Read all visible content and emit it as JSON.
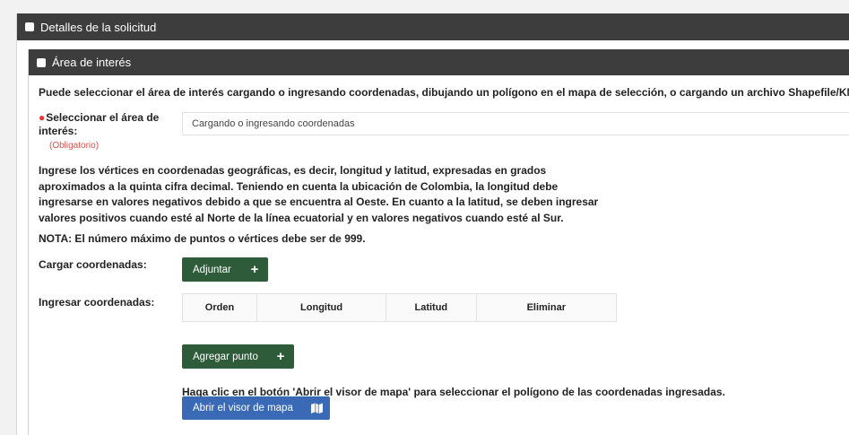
{
  "outer_panel": {
    "title": "Detalles de la solicitud"
  },
  "inner_panel": {
    "title": "Área de interés"
  },
  "intro_text": "Puede seleccionar el área de interés cargando o ingresando coordenadas, dibujando un polígono en el mapa de selección, o cargando un archivo Shapefile/KML",
  "select_area": {
    "label_line1": "Seleccionar el área de",
    "label_line2": "interés:",
    "required_note": "(Obligatorio)",
    "selected_value": "Cargando o ingresando coordenadas"
  },
  "instructions": "Ingrese los vértices en coordenadas geográficas, es decir, longitud y latitud, expresadas en grados aproximados a la quinta cifra decimal. Teniendo en cuenta la ubicación de Colombia, la longitud debe ingresarse en valores negativos debido a que se encuentra al Oeste. En cuanto a la latitud, se deben ingresar valores positivos cuando esté al Norte de la línea ecuatorial y en valores negativos cuando esté al Sur.",
  "nota": "NOTA: El número máximo de puntos o vértices debe ser de 999.",
  "upload": {
    "label": "Cargar coordenadas:",
    "button": "Adjuntar",
    "button_icon": "plus-icon"
  },
  "enter": {
    "label": "Ingresar coordenadas:",
    "columns": [
      "Orden",
      "Longitud",
      "Latitud",
      "Eliminar"
    ],
    "add_button": "Agregar punto",
    "add_icon": "plus-icon"
  },
  "map": {
    "hint": "Haga clic en el botón 'Abrir el visor de mapa' para seleccionar el polígono de las coordenadas ingresadas.",
    "button": "Abrir el visor de mapa",
    "button_icon": "map-icon"
  },
  "colors": {
    "header_bg": "#3d3d3d",
    "green_button": "#2e5b3a",
    "blue_button": "#3a69b5",
    "required": "#d9534f"
  }
}
